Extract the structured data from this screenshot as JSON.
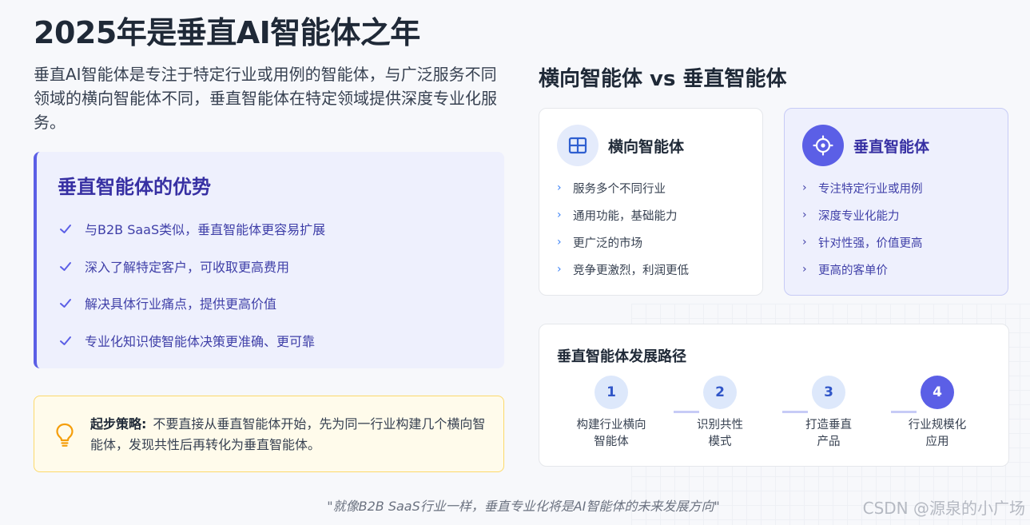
{
  "title": "2025年是垂直AI智能体之年",
  "intro": "垂直AI智能体是专注于特定行业或用例的智能体，与广泛服务不同领域的横向智能体不同，垂直智能体在特定领域提供深度专业化服务。",
  "advantages": {
    "title": "垂直智能体的优势",
    "items": [
      "与B2B SaaS类似，垂直智能体更容易扩展",
      "深入了解特定客户，可收取更高费用",
      "解决具体行业痛点，提供更高价值",
      "专业化知识使智能体决策更准确、更可靠"
    ]
  },
  "tip": {
    "label": "起步策略:",
    "text": "不要直接从垂直智能体开始，先为同一行业构建几个横向智能体，发现共性后再转化为垂直智能体。"
  },
  "compare": {
    "title": "横向智能体 vs 垂直智能体",
    "horizontal": {
      "title": "横向智能体",
      "icon": "grid-icon",
      "items": [
        "服务多个不同行业",
        "通用功能，基础能力",
        "更广泛的市场",
        "竞争更激烈，利润更低"
      ]
    },
    "vertical": {
      "title": "垂直智能体",
      "icon": "target-icon",
      "items": [
        "专注特定行业或用例",
        "深度专业化能力",
        "针对性强，价值更高",
        "更高的客单价"
      ]
    }
  },
  "path": {
    "title": "垂直智能体发展路径",
    "steps": [
      {
        "num": "1",
        "line1": "构建行业横向",
        "line2": "智能体"
      },
      {
        "num": "2",
        "line1": "识别共性",
        "line2": "模式"
      },
      {
        "num": "3",
        "line1": "打造垂直",
        "line2": "产品"
      },
      {
        "num": "4",
        "line1": "行业规模化",
        "line2": "应用"
      }
    ],
    "active_step": 4
  },
  "quote": "\"就像B2B SaaS行业一样，垂直专业化将是AI智能体的未来发展方向\"",
  "watermark": "CSDN @源泉的小广场",
  "colors": {
    "accent": "#5b5fe6",
    "accent_dark": "#3730a3",
    "tip_bg": "#fffbeb",
    "tip_border": "#fcd96b"
  }
}
